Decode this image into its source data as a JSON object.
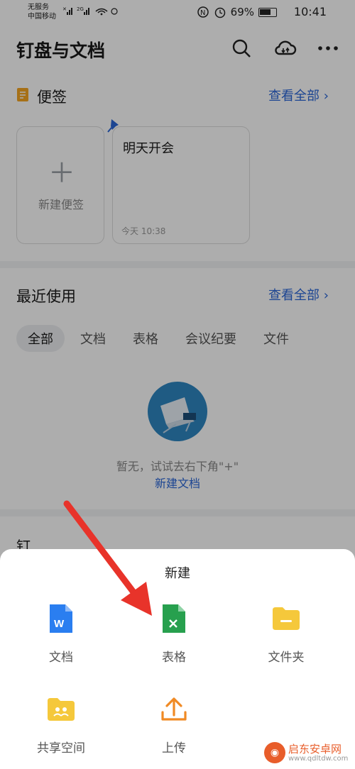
{
  "status_bar": {
    "carrier_line1": "无服务",
    "carrier_line2": "中国移动",
    "network": "2G",
    "battery": "69%",
    "time": "10:41"
  },
  "header": {
    "title": "钉盘与文档",
    "icons": [
      "search-icon",
      "cloud-sync-icon",
      "more-icon"
    ]
  },
  "notes": {
    "title": "便签",
    "see_all": "查看全部",
    "new_note_label": "新建便签",
    "cards": [
      {
        "title": "明天开会",
        "time": "今天 10:38"
      }
    ]
  },
  "recent": {
    "title": "最近使用",
    "see_all": "查看全部",
    "filters": [
      "全部",
      "文档",
      "表格",
      "会议纪要",
      "文件"
    ],
    "active_filter": "全部",
    "empty_text": "暂无，试试去右下角\"+\"",
    "empty_link": "新建文档"
  },
  "below_section": {
    "partial_title": "钉"
  },
  "sheet": {
    "title": "新建",
    "options": [
      {
        "label": "文档",
        "icon": "doc-icon",
        "color": "#2a7ef0"
      },
      {
        "label": "表格",
        "icon": "sheet-icon",
        "color": "#27a04e"
      },
      {
        "label": "文件夹",
        "icon": "folder-icon",
        "color": "#f5c83b"
      },
      {
        "label": "共享空间",
        "icon": "shared-space-icon",
        "color": "#f5c83b"
      },
      {
        "label": "上传",
        "icon": "upload-icon",
        "color": "#f08a24"
      }
    ]
  },
  "watermark": {
    "text": "启东安卓网",
    "url": "www.qdltdw.com"
  },
  "colors": {
    "accent": "#2a66d8",
    "annotation_arrow": "#e8332a"
  }
}
